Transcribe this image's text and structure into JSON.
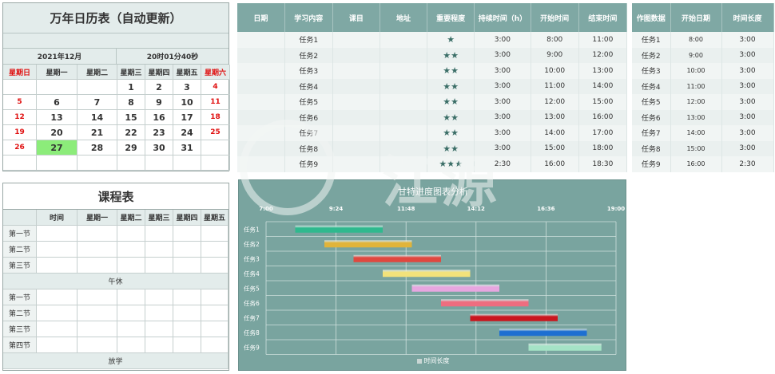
{
  "calendar": {
    "title": "万年日历表（自动更新）",
    "year_month": "2021年12月",
    "time": "20时01分40秒",
    "weekdays": [
      "星期日",
      "星期一",
      "星期二",
      "星期三",
      "星期四",
      "星期五",
      "星期六"
    ],
    "weeks": [
      [
        "",
        "",
        "",
        "1",
        "2",
        "3",
        "4"
      ],
      [
        "5",
        "6",
        "7",
        "8",
        "9",
        "10",
        "11"
      ],
      [
        "12",
        "13",
        "14",
        "15",
        "16",
        "17",
        "18"
      ],
      [
        "19",
        "20",
        "21",
        "22",
        "23",
        "24",
        "25"
      ],
      [
        "26",
        "27",
        "28",
        "29",
        "30",
        "31",
        ""
      ],
      [
        "",
        "",
        "",
        "",
        "",
        "",
        ""
      ]
    ],
    "today": "27",
    "weekend_color": "#e01010",
    "today_color": "#8cec7a"
  },
  "schedule": {
    "title": "课程表",
    "headers": [
      "",
      "时间",
      "星期一",
      "星期二",
      "星期三",
      "星期四",
      "星期五"
    ],
    "morning": [
      "第一节",
      "第二节",
      "第三节"
    ],
    "break_label": "午休",
    "afternoon": [
      "第一节",
      "第二节",
      "第三节",
      "第四节"
    ],
    "end_label": "放学"
  },
  "tasks": {
    "headers": [
      "日期",
      "学习内容",
      "课目",
      "地址",
      "重要程度",
      "持续时间（h）",
      "开始时间",
      "结束时间"
    ],
    "rows": [
      {
        "name": "任务1",
        "stars": "★",
        "duration": "3:00",
        "start": "8:00",
        "end": "11:00"
      },
      {
        "name": "任务2",
        "stars": "★★",
        "duration": "3:00",
        "start": "9:00",
        "end": "12:00"
      },
      {
        "name": "任务3",
        "stars": "★★",
        "duration": "3:00",
        "start": "10:00",
        "end": "13:00"
      },
      {
        "name": "任务4",
        "stars": "★★",
        "duration": "3:00",
        "start": "11:00",
        "end": "14:00"
      },
      {
        "name": "任务5",
        "stars": "★★",
        "duration": "3:00",
        "start": "12:00",
        "end": "15:00"
      },
      {
        "name": "任务6",
        "stars": "★★",
        "duration": "3:00",
        "start": "13:00",
        "end": "16:00"
      },
      {
        "name": "任务7",
        "stars": "★★",
        "duration": "3:00",
        "start": "14:00",
        "end": "17:00"
      },
      {
        "name": "任务8",
        "stars": "★★",
        "duration": "3:00",
        "start": "15:00",
        "end": "18:00"
      },
      {
        "name": "任务9",
        "stars": "★★★",
        "duration": "2:30",
        "start": "16:00",
        "end": "18:30"
      }
    ]
  },
  "side": {
    "headers": [
      "作图数据",
      "开始日期",
      "时间长度"
    ],
    "rows": [
      [
        "任务1",
        "8:00",
        "3:00"
      ],
      [
        "任务2",
        "9:00",
        "3:00"
      ],
      [
        "任务3",
        "10:00",
        "3:00"
      ],
      [
        "任务4",
        "11:00",
        "3:00"
      ],
      [
        "任务5",
        "12:00",
        "3:00"
      ],
      [
        "任务6",
        "13:00",
        "3:00"
      ],
      [
        "任务7",
        "14:00",
        "3:00"
      ],
      [
        "任务8",
        "15:00",
        "3:00"
      ],
      [
        "任务9",
        "16:00",
        "2:30"
      ]
    ]
  },
  "chart_data": {
    "type": "bar",
    "title": "甘特进度图表分析",
    "legend": "时间长度",
    "x_ticks": [
      "7:00",
      "9:24",
      "11:48",
      "14:12",
      "16:36",
      "19:00"
    ],
    "xlim": [
      "7:00",
      "19:00"
    ],
    "categories": [
      "任务1",
      "任务2",
      "任务3",
      "任务4",
      "任务5",
      "任务6",
      "任务7",
      "任务8",
      "任务9"
    ],
    "start": [
      "8:00",
      "9:00",
      "10:00",
      "11:00",
      "12:00",
      "13:00",
      "14:00",
      "15:00",
      "16:00"
    ],
    "duration": [
      "3:00",
      "3:00",
      "3:00",
      "3:00",
      "3:00",
      "3:00",
      "3:00",
      "3:00",
      "2:30"
    ],
    "colors": [
      "#2fb98e",
      "#e0b43a",
      "#e0483f",
      "#f2e27a",
      "#e7a6e0",
      "#ee6d7f",
      "#c9161e",
      "#1d6fd1",
      "#a5e3c6"
    ],
    "grid": true
  },
  "watermark": {
    "text": "江源"
  }
}
